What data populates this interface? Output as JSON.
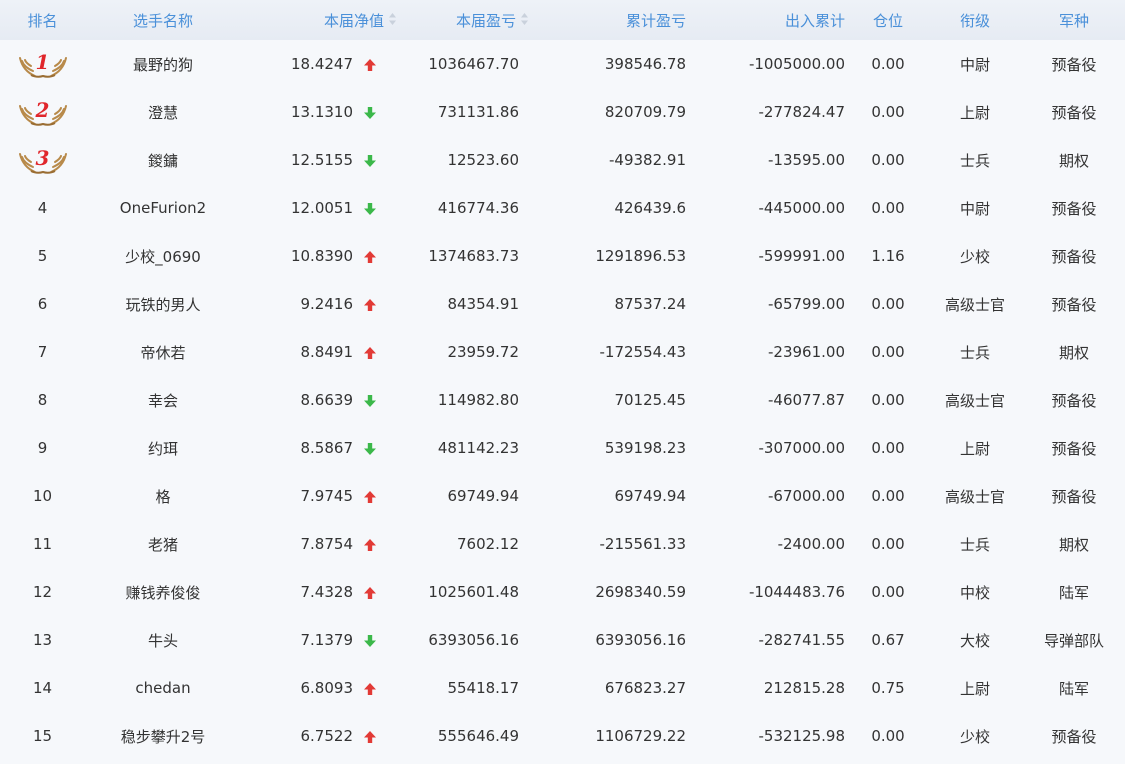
{
  "colors": {
    "header_text": "#4a90d9",
    "up": "#e23a36",
    "down": "#3bb84a",
    "medal_number": "#e0262b",
    "wing": "#b88a4a"
  },
  "icons": {
    "sort": "sort-updown-icon",
    "up": "arrow-up-icon",
    "down": "arrow-down-icon",
    "medal": "wings-icon"
  },
  "headers": {
    "rank": "排名",
    "name": "选手名称",
    "nav": "本届净值",
    "pnl": "本届盈亏",
    "cum_pnl": "累计盈亏",
    "flow": "出入累计",
    "position": "仓位",
    "title": "衔级",
    "branch": "军种"
  },
  "rows": [
    {
      "rank": "1",
      "name": "最野的狗",
      "nav": "18.4247",
      "trend": "up",
      "pnl": "1036467.70",
      "cum_pnl": "398546.78",
      "flow": "-1005000.00",
      "position": "0.00",
      "title": "中尉",
      "branch": "预备役"
    },
    {
      "rank": "2",
      "name": "澄慧",
      "nav": "13.1310",
      "trend": "down",
      "pnl": "731131.86",
      "cum_pnl": "820709.79",
      "flow": "-277824.47",
      "position": "0.00",
      "title": "上尉",
      "branch": "预备役"
    },
    {
      "rank": "3",
      "name": "鍐鏞",
      "nav": "12.5155",
      "trend": "down",
      "pnl": "12523.60",
      "cum_pnl": "-49382.91",
      "flow": "-13595.00",
      "position": "0.00",
      "title": "士兵",
      "branch": "期权"
    },
    {
      "rank": "4",
      "name": "OneFurion2",
      "nav": "12.0051",
      "trend": "down",
      "pnl": "416774.36",
      "cum_pnl": "426439.6",
      "flow": "-445000.00",
      "position": "0.00",
      "title": "中尉",
      "branch": "预备役"
    },
    {
      "rank": "5",
      "name": "少校_0690",
      "nav": "10.8390",
      "trend": "up",
      "pnl": "1374683.73",
      "cum_pnl": "1291896.53",
      "flow": "-599991.00",
      "position": "1.16",
      "title": "少校",
      "branch": "预备役"
    },
    {
      "rank": "6",
      "name": "玩铁的男人",
      "nav": "9.2416",
      "trend": "up",
      "pnl": "84354.91",
      "cum_pnl": "87537.24",
      "flow": "-65799.00",
      "position": "0.00",
      "title": "高级士官",
      "branch": "预备役"
    },
    {
      "rank": "7",
      "name": "帝休若",
      "nav": "8.8491",
      "trend": "up",
      "pnl": "23959.72",
      "cum_pnl": "-172554.43",
      "flow": "-23961.00",
      "position": "0.00",
      "title": "士兵",
      "branch": "期权"
    },
    {
      "rank": "8",
      "name": "幸会",
      "nav": "8.6639",
      "trend": "down",
      "pnl": "114982.80",
      "cum_pnl": "70125.45",
      "flow": "-46077.87",
      "position": "0.00",
      "title": "高级士官",
      "branch": "预备役"
    },
    {
      "rank": "9",
      "name": "约珥",
      "nav": "8.5867",
      "trend": "down",
      "pnl": "481142.23",
      "cum_pnl": "539198.23",
      "flow": "-307000.00",
      "position": "0.00",
      "title": "上尉",
      "branch": "预备役"
    },
    {
      "rank": "10",
      "name": "格",
      "nav": "7.9745",
      "trend": "up",
      "pnl": "69749.94",
      "cum_pnl": "69749.94",
      "flow": "-67000.00",
      "position": "0.00",
      "title": "高级士官",
      "branch": "预备役"
    },
    {
      "rank": "11",
      "name": "老猪",
      "nav": "7.8754",
      "trend": "up",
      "pnl": "7602.12",
      "cum_pnl": "-215561.33",
      "flow": "-2400.00",
      "position": "0.00",
      "title": "士兵",
      "branch": "期权"
    },
    {
      "rank": "12",
      "name": "赚钱养俊俊",
      "nav": "7.4328",
      "trend": "up",
      "pnl": "1025601.48",
      "cum_pnl": "2698340.59",
      "flow": "-1044483.76",
      "position": "0.00",
      "title": "中校",
      "branch": "陆军"
    },
    {
      "rank": "13",
      "name": "牛头",
      "nav": "7.1379",
      "trend": "down",
      "pnl": "6393056.16",
      "cum_pnl": "6393056.16",
      "flow": "-282741.55",
      "position": "0.67",
      "title": "大校",
      "branch": "导弹部队"
    },
    {
      "rank": "14",
      "name": "chedan",
      "nav": "6.8093",
      "trend": "up",
      "pnl": "55418.17",
      "cum_pnl": "676823.27",
      "flow": "212815.28",
      "position": "0.75",
      "title": "上尉",
      "branch": "陆军"
    },
    {
      "rank": "15",
      "name": "稳步攀升2号",
      "nav": "6.7522",
      "trend": "up",
      "pnl": "555646.49",
      "cum_pnl": "1106729.22",
      "flow": "-532125.98",
      "position": "0.00",
      "title": "少校",
      "branch": "预备役"
    }
  ]
}
